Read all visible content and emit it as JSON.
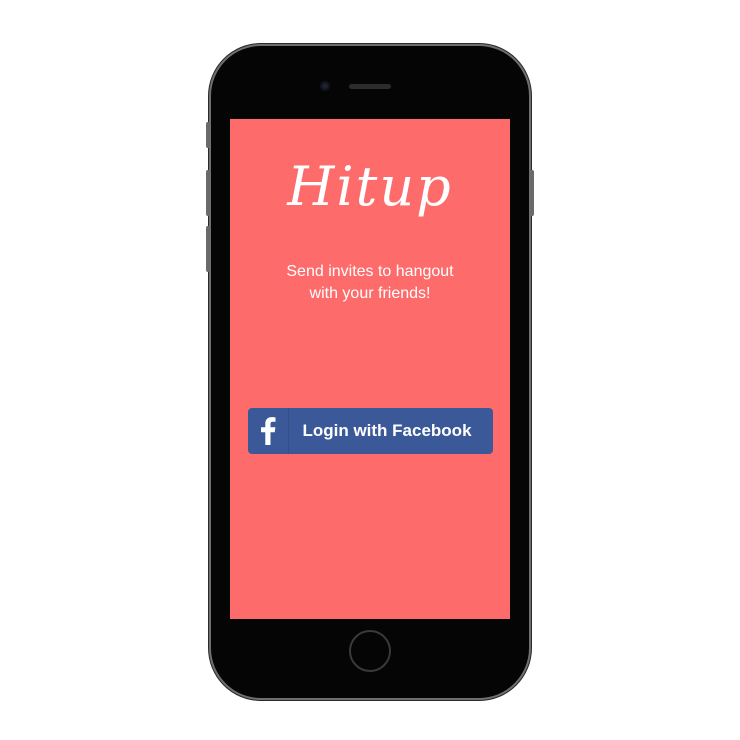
{
  "app": {
    "name": "Hitup",
    "tagline_line1": "Send invites to hangout",
    "tagline_line2": "with your friends!"
  },
  "login": {
    "facebook_label": "Login with Facebook",
    "icon": "facebook-icon"
  },
  "colors": {
    "screen_background": "#fe6b6b",
    "facebook_blue": "#3b5998",
    "text": "#ffffff"
  }
}
